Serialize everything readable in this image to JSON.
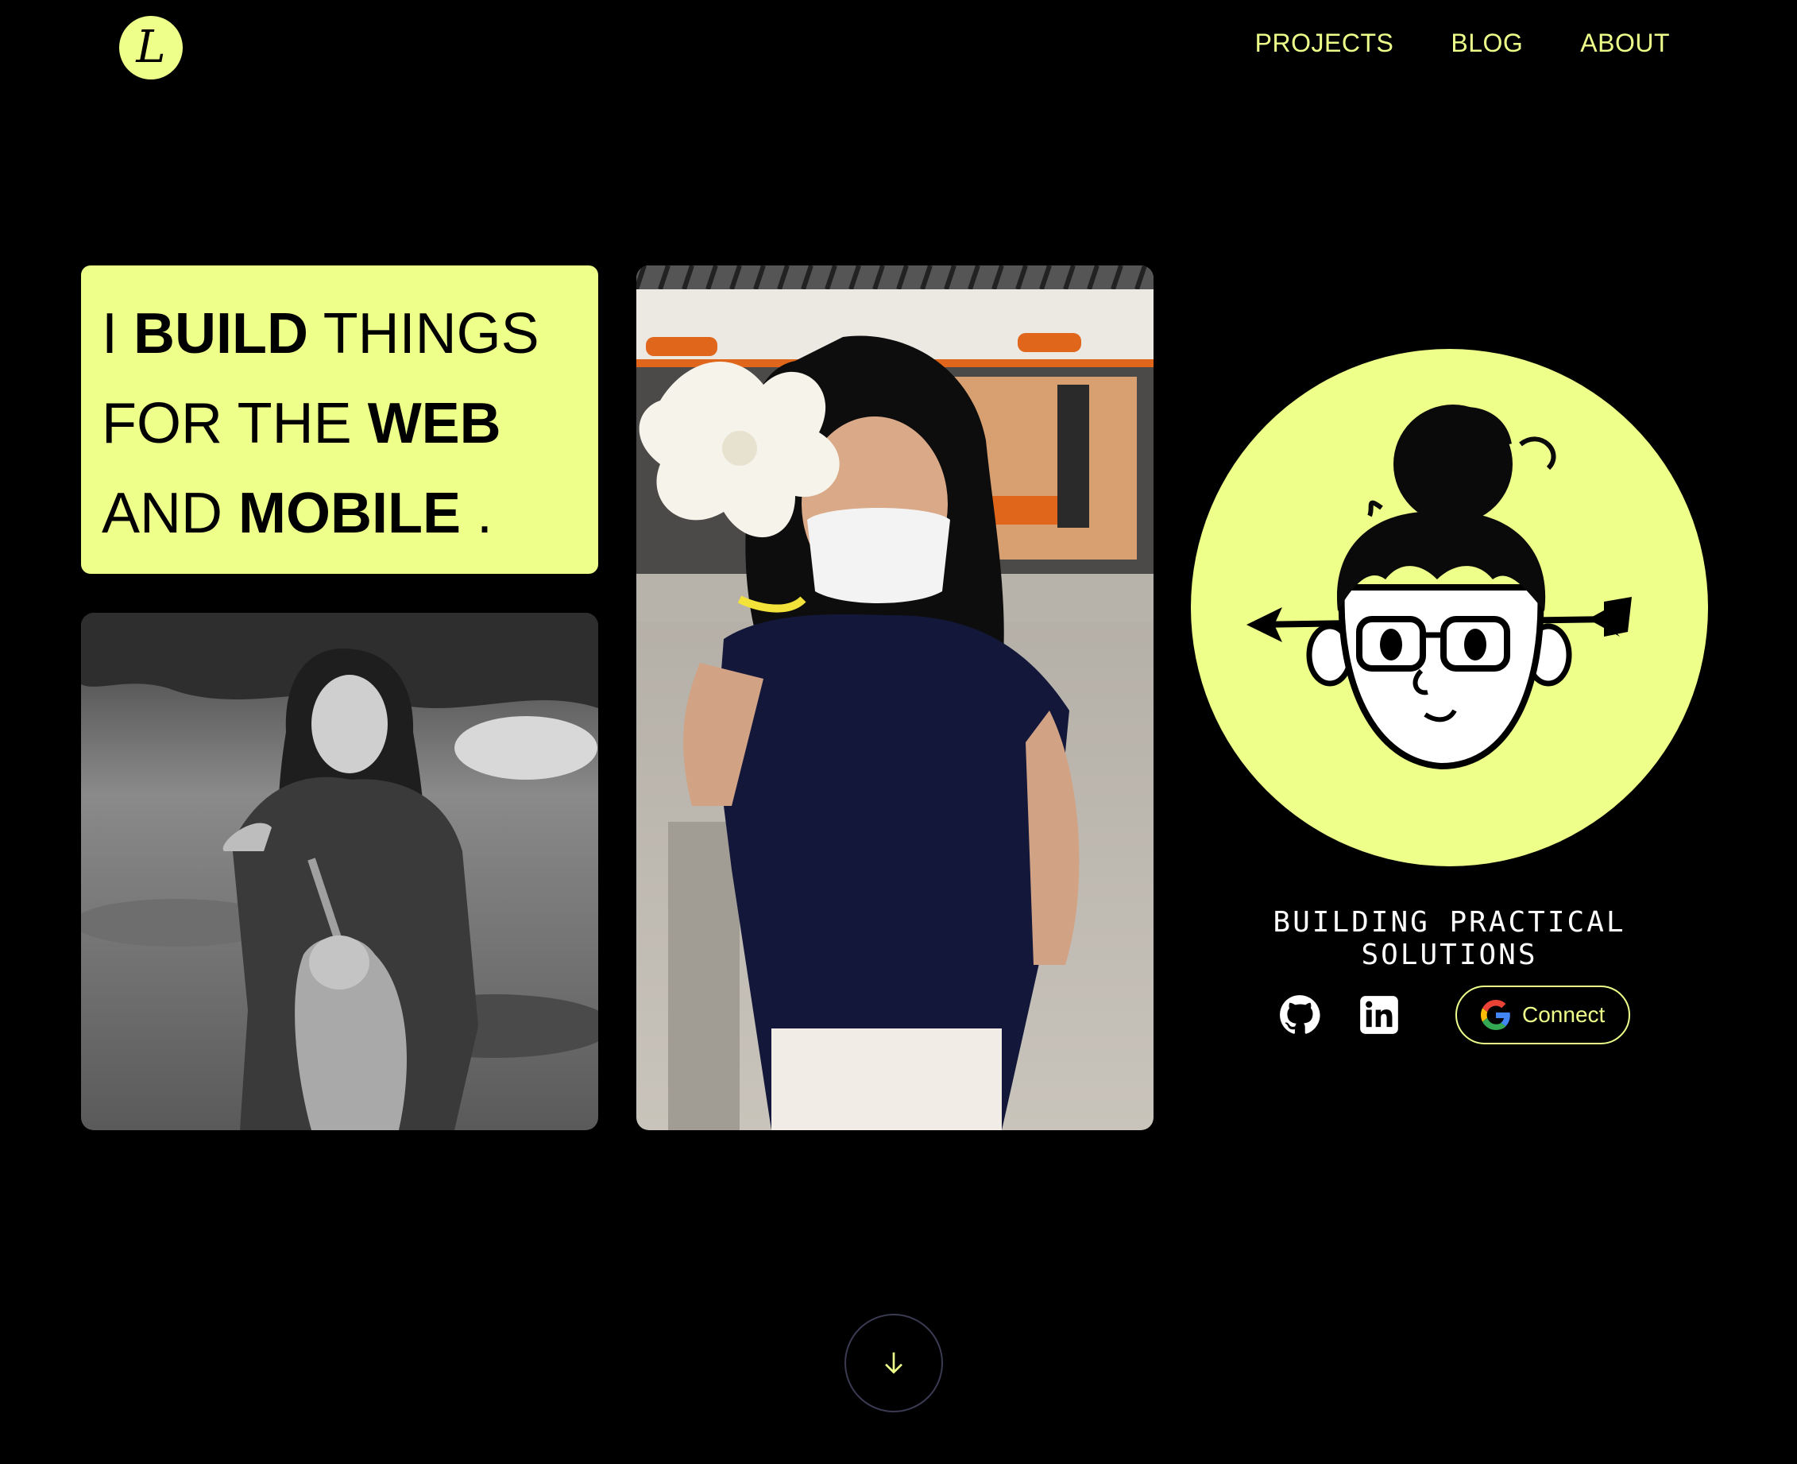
{
  "logo": {
    "letter": "L"
  },
  "nav": {
    "projects": "PROJECTS",
    "blog": "BLOG",
    "about": "ABOUT"
  },
  "headline": {
    "line1_a": "I ",
    "line1_b": "BUILD",
    "line1_c": " THINGS",
    "line2_a": "FOR THE ",
    "line2_b": "WEB",
    "line3_a": "AND ",
    "line3_b": "MOBILE",
    "line3_c": " ."
  },
  "tagline": "BUILDING PRACTICAL SOLUTIONS",
  "socials": {
    "github_icon": "github-icon",
    "linkedin_icon": "linkedin-icon",
    "connect_label": "Connect"
  },
  "colors": {
    "accent": "#eeff8a",
    "background": "#000000"
  }
}
